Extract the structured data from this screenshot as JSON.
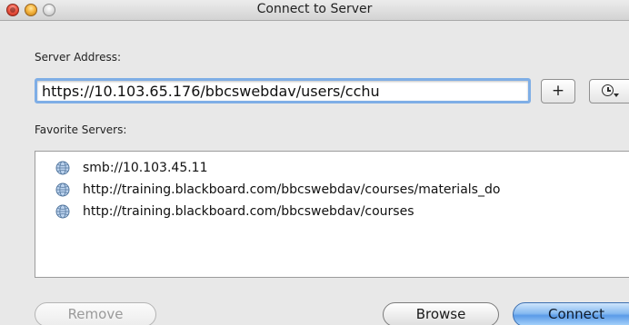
{
  "window": {
    "title": "Connect to Server"
  },
  "form": {
    "server_address_label": "Server Address:",
    "server_address_value": "https://10.103.65.176/bbcswebdav/users/cchu",
    "add_button_label": "+",
    "favorites_label": "Favorite Servers:"
  },
  "favorites": [
    {
      "url": "smb://10.103.45.11",
      "icon": "network-globe-icon"
    },
    {
      "url": "http://training.blackboard.com/bbcswebdav/courses/materials_do",
      "icon": "network-globe-icon"
    },
    {
      "url": "http://training.blackboard.com/bbcswebdav/courses",
      "icon": "network-globe-icon"
    }
  ],
  "buttons": {
    "remove": "Remove",
    "browse": "Browse",
    "connect": "Connect"
  },
  "colors": {
    "focus_ring": "#7faee6",
    "default_button": "#5b9be8",
    "window_background": "#e8e8e8"
  }
}
